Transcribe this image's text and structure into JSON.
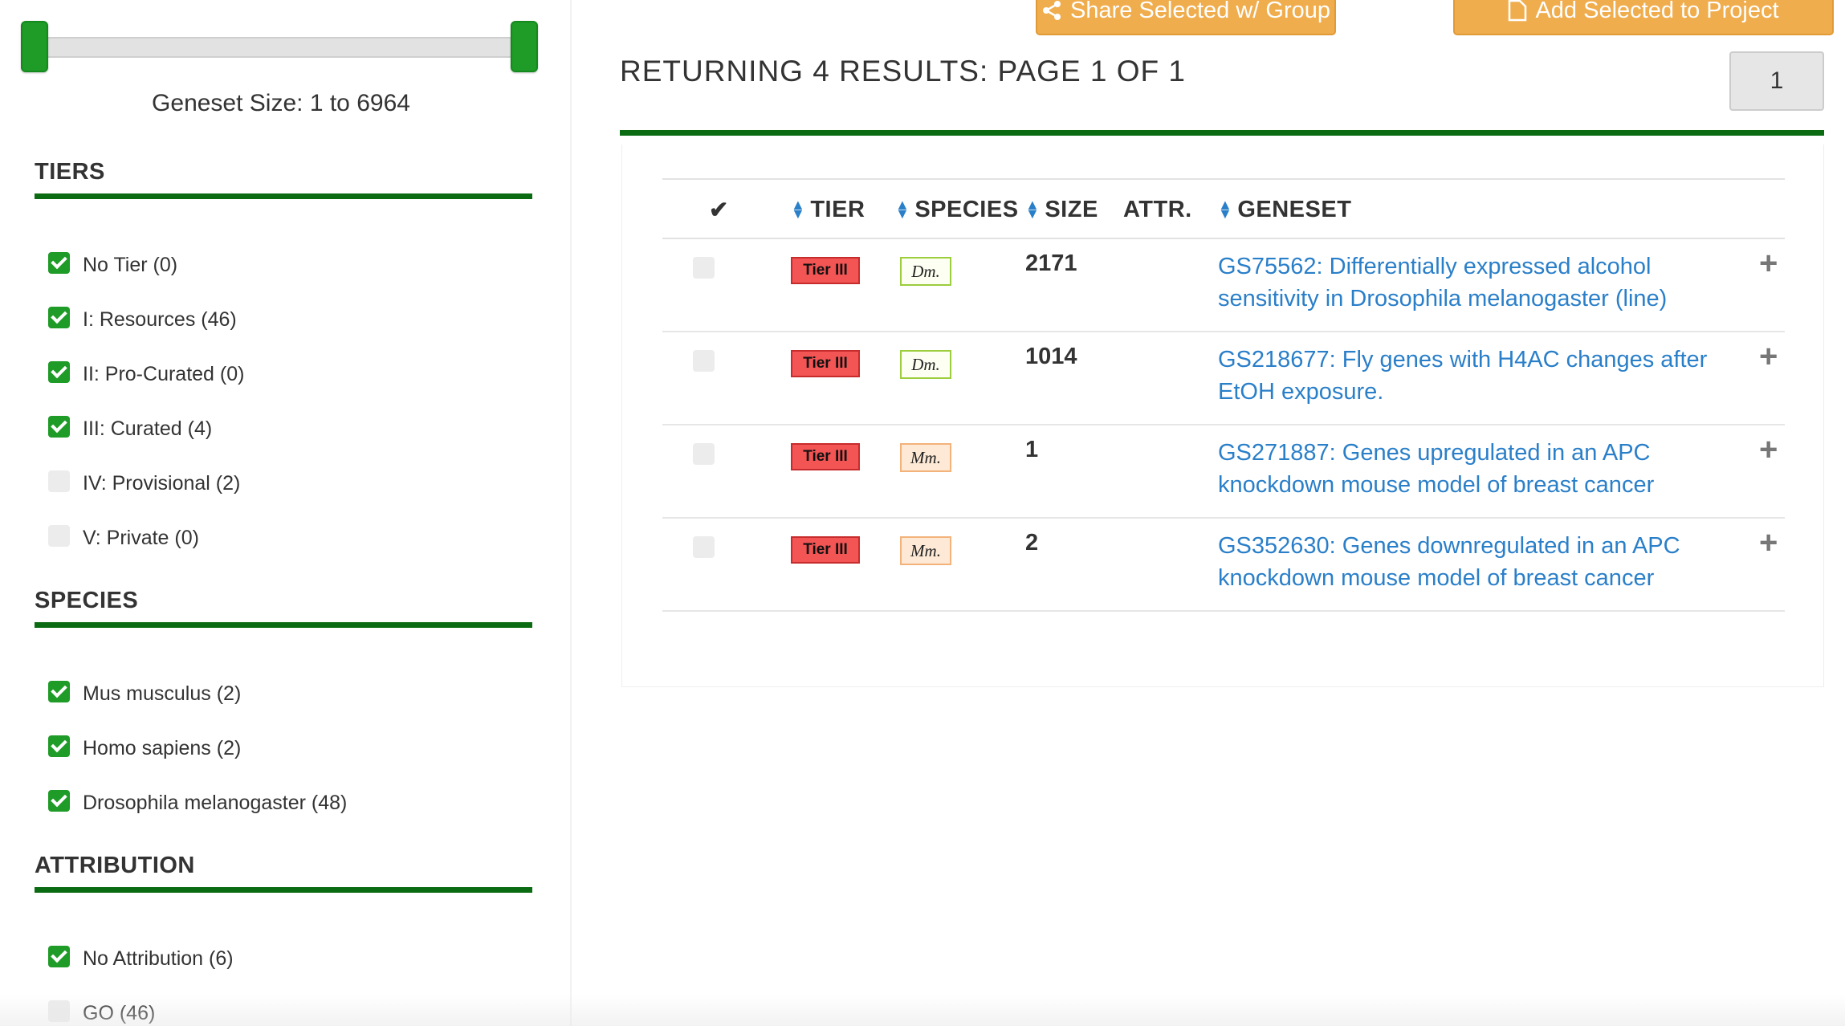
{
  "sidebar": {
    "geneset_size_label": "Geneset Size: 1 to 6964",
    "sections": [
      {
        "title": "TIERS",
        "items": [
          {
            "label": "No Tier (0)",
            "checked": true
          },
          {
            "label": "I: Resources (46)",
            "checked": true
          },
          {
            "label": "II: Pro-Curated (0)",
            "checked": true
          },
          {
            "label": "III: Curated (4)",
            "checked": true
          },
          {
            "label": "IV: Provisional (2)",
            "checked": false
          },
          {
            "label": "V: Private (0)",
            "checked": false
          }
        ]
      },
      {
        "title": "SPECIES",
        "items": [
          {
            "label": "Mus musculus (2)",
            "checked": true
          },
          {
            "label": "Homo sapiens (2)",
            "checked": true
          },
          {
            "label": "Drosophila melanogaster (48)",
            "checked": true
          }
        ]
      },
      {
        "title": "ATTRIBUTION",
        "items": [
          {
            "label": "No Attribution (6)",
            "checked": true
          },
          {
            "label": "GO (46)",
            "checked": false
          }
        ]
      }
    ]
  },
  "toolbar": {
    "share_label": "Share Selected w/ Group",
    "add_label": "Add Selected to Project",
    "share_icon": "share-icon",
    "add_icon": "file-icon"
  },
  "results": {
    "heading": "RETURNING 4 RESULTS: PAGE 1 OF 1",
    "page_number": "1",
    "columns": {
      "select": "✔",
      "tier": "TIER",
      "species": "SPECIES",
      "size": "SIZE",
      "attr": "ATTR.",
      "geneset": "GENESET"
    },
    "rows": [
      {
        "tier": "Tier III",
        "species": "Dm.",
        "species_code": "dm",
        "size": "2171",
        "geneset": "GS75562: Differentially expressed alcohol sensitivity in Drosophila melanogaster (line)"
      },
      {
        "tier": "Tier III",
        "species": "Dm.",
        "species_code": "dm",
        "size": "1014",
        "geneset": "GS218677: Fly genes with H4AC changes after EtOH exposure."
      },
      {
        "tier": "Tier III",
        "species": "Mm.",
        "species_code": "mm",
        "size": "1",
        "geneset": "GS271887: Genes upregulated in an APC knockdown mouse model of breast cancer"
      },
      {
        "tier": "Tier III",
        "species": "Mm.",
        "species_code": "mm",
        "size": "2",
        "geneset": "GS352630: Genes downregulated in an APC knockdown mouse model of breast cancer"
      }
    ],
    "expand_symbol": "+"
  },
  "colors": {
    "accent_green": "#0b6b12",
    "checkbox_green": "#1f9b27",
    "button_orange": "#f0ad4e",
    "link_blue": "#2a7fc9",
    "tier_red": "#f35454"
  }
}
